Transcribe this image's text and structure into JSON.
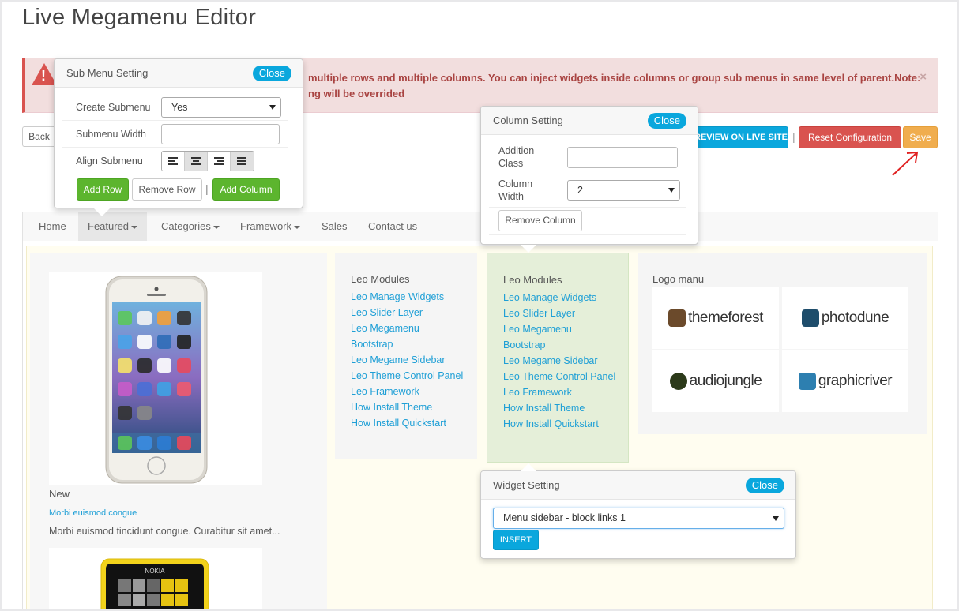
{
  "page": {
    "title": "Live Megamenu Editor"
  },
  "alert": {
    "line1": "multiple rows and multiple columns. You can inject widgets inside columns or group sub menus in same level of parent.Note:",
    "line2": "ng will be overrided",
    "close": "×"
  },
  "toolbar": {
    "back": "Back",
    "preview": "REVIEW ON LIVE SITE",
    "reset": "Reset Configuration",
    "save": "Save",
    "separator": "|"
  },
  "nav": {
    "items": [
      {
        "label": "Home",
        "dropdown": false
      },
      {
        "label": "Featured",
        "dropdown": true
      },
      {
        "label": "Categories",
        "dropdown": true
      },
      {
        "label": "Framework",
        "dropdown": true
      },
      {
        "label": "Sales",
        "dropdown": false
      },
      {
        "label": "Contact us",
        "dropdown": false
      }
    ]
  },
  "product": {
    "label": "New",
    "link": "Morbi euismod congue",
    "description": "Morbi euismod tincidunt congue. Curabitur sit amet..."
  },
  "modules": {
    "heading": "Leo Modules",
    "links": [
      "Leo Manage Widgets",
      "Leo Slider Layer",
      "Leo Megamenu",
      "Bootstrap",
      "Leo Megame Sidebar",
      "Leo Theme Control Panel",
      "Leo Framework",
      "How Install Theme",
      "How Install Quickstart"
    ]
  },
  "logos": {
    "title": "Logo manu",
    "items": [
      "themeforest",
      "photodune",
      "audiojungle",
      "graphicriver"
    ]
  },
  "submenu_popup": {
    "title": "Sub Menu Setting",
    "close": "Close",
    "create_label": "Create Submenu",
    "create_value": "Yes",
    "width_label": "Submenu Width",
    "width_value": "",
    "align_label": "Align Submenu",
    "add_row": "Add Row",
    "remove_row": "Remove Row",
    "separator": "|",
    "add_column": "Add Column"
  },
  "column_popup": {
    "title": "Column Setting",
    "close": "Close",
    "class_label_1": "Addition",
    "class_label_2": "Class",
    "class_value": "",
    "width_label_1": "Column",
    "width_label_2": "Width",
    "width_value": "2",
    "remove_column": "Remove Column"
  },
  "widget_popup": {
    "title": "Widget Setting",
    "close": "Close",
    "select_value": "Menu sidebar - block links 1",
    "insert": "INSERT"
  },
  "colors": {
    "accent_blue": "#0aa7dd",
    "link_blue": "#1e9fd6",
    "danger": "#d9534f",
    "warning": "#f0ad4e",
    "success": "#5cb52e",
    "alert_bg": "#f2dede"
  }
}
